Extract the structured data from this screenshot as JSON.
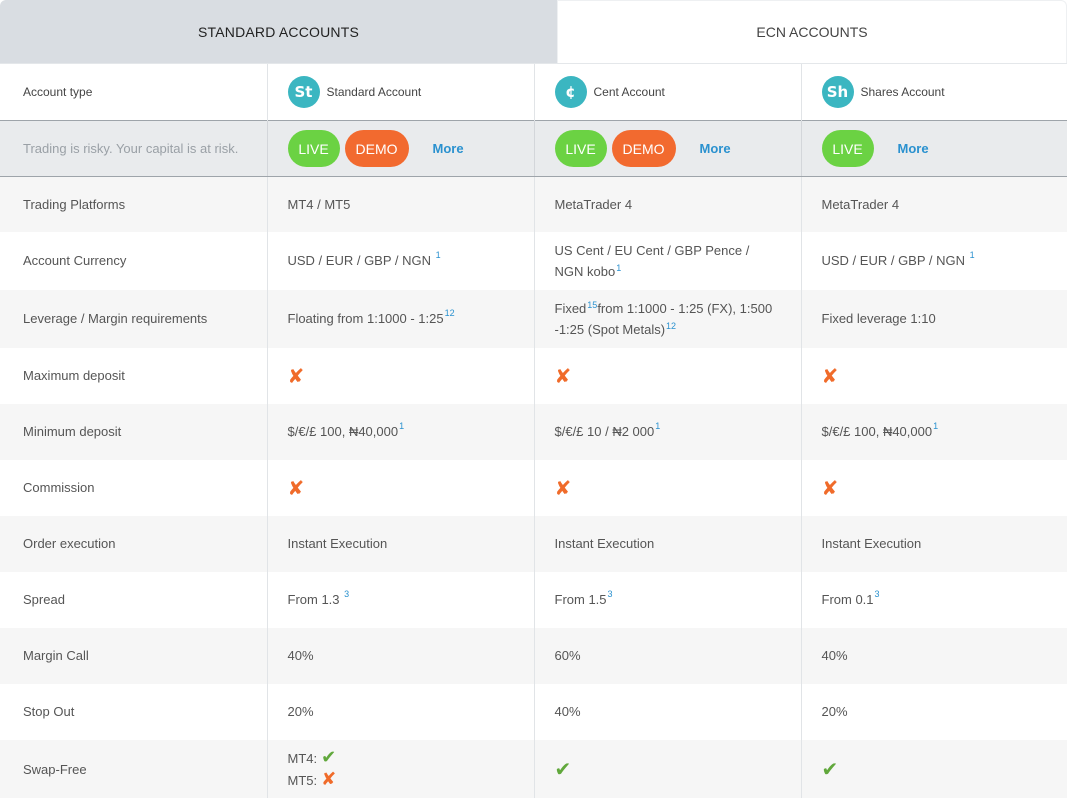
{
  "tabs": {
    "standard": "STANDARD ACCOUNTS",
    "ecn": "ECN ACCOUNTS"
  },
  "header": {
    "label": "Account type",
    "accounts": [
      {
        "logo": "St",
        "name": "Standard Account"
      },
      {
        "logo": "¢",
        "name": "Cent Account"
      },
      {
        "logo": "Sh",
        "name": "Shares Account"
      }
    ]
  },
  "actions": {
    "risk_text": "Trading is risky. Your capital is at risk.",
    "live": "LIVE",
    "demo": "DEMO",
    "more": "More"
  },
  "rows": {
    "platforms": {
      "label": "Trading Platforms",
      "v1": "MT4 / MT5",
      "v2": "MetaTrader 4",
      "v3": "MetaTrader 4"
    },
    "currency": {
      "label": "Account Currency",
      "v1": "USD / EUR / GBP / NGN",
      "v1_sup": "1",
      "v2": "US Cent / EU Cent / GBP Pence / NGN kobo",
      "v2_sup": "1",
      "v3": "USD / EUR / GBP / NGN",
      "v3_sup": "1"
    },
    "leverage": {
      "label": "Leverage / Margin requirements",
      "v1": "Floating from 1:1000 - 1:25",
      "v1_sup": "12",
      "v2_a": "Fixed",
      "v2_sup_a": "15",
      "v2_b": "from 1:1000 - 1:25 (FX), 1:500 -1:25 (Spot Metals)",
      "v2_sup_b": "12",
      "v3": "Fixed leverage 1:10"
    },
    "max_deposit": {
      "label": "Maximum deposit"
    },
    "min_deposit": {
      "label": "Minimum deposit",
      "v1": "$/€/£ 100, ₦40,000",
      "v1_sup": "1",
      "v2": "$/€/£ 10 / ₦2 000",
      "v2_sup": "1",
      "v3": "$/€/£ 100, ₦40,000",
      "v3_sup": "1"
    },
    "commission": {
      "label": "Commission"
    },
    "execution": {
      "label": "Order execution",
      "v1": "Instant Execution",
      "v2": "Instant Execution",
      "v3": "Instant Execution"
    },
    "spread": {
      "label": "Spread",
      "v1": "From 1.3",
      "v1_sup": "3",
      "v2": "From 1.5",
      "v2_sup": "3",
      "v3": "From 0.1",
      "v3_sup": "3"
    },
    "margin_call": {
      "label": "Margin Call",
      "v1": "40%",
      "v2": "60%",
      "v3": "40%"
    },
    "stop_out": {
      "label": "Stop Out",
      "v1": "20%",
      "v2": "40%",
      "v3": "20%"
    },
    "swap_free": {
      "label": "Swap-Free",
      "mt4": "MT4:",
      "mt5": "MT5:"
    }
  },
  "icons": {
    "no": "✘",
    "yes": "✔"
  },
  "colors": {
    "live": "#6bd243",
    "demo": "#f26a2f",
    "link": "#2a91cf",
    "cross": "#f06b2a",
    "check": "#61a83c",
    "logo": "#3bb6c1"
  }
}
